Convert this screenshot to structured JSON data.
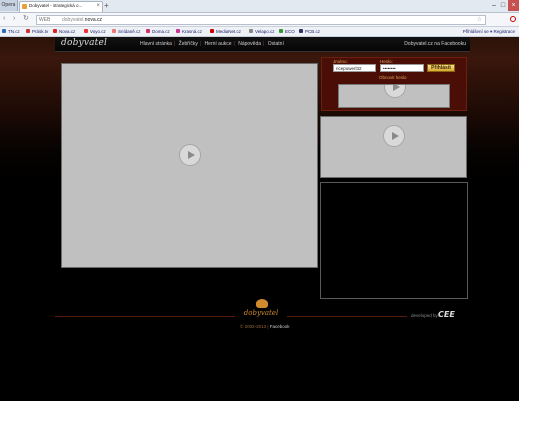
{
  "browser": {
    "menu_label": "Opera",
    "tab_title": "Dobyvatel - strategická o...",
    "tab_close": "×",
    "new_tab": "+",
    "address_domain_faded": "dobyvatel.",
    "address_domain_strong": "novа.cz",
    "web_badge": "WEB",
    "bookmarks": [
      "TN.cz",
      "Prásk.tv",
      "Nova.cz",
      "Voyo.cz",
      "Snídaně.cz",
      "Doma.cz",
      "Krasná.cz",
      "MediaNet.cz",
      "Velapo.cz",
      "ECO",
      "PCB.cz"
    ],
    "bookmarks_right": "Přihlášení se ▾   Registrace"
  },
  "site": {
    "logo": "dobyvatel",
    "menu": [
      "Hlavní stránka",
      "Žebříčky",
      "Herní aukce",
      "Nápověda",
      "Ostatní"
    ],
    "facebook_link": "Dobyvatel.cz na Facebooku",
    "login": {
      "username_label": "Jméno:",
      "username_value": "ricepowerl32",
      "password_label": "Heslo:",
      "password_value": "••••••••",
      "submit": "Přihlásit",
      "recover": "Obnovit heslo"
    },
    "footer": {
      "logo": "dobyvatel",
      "copyright": "© 2002-2013",
      "copyright_link": "Facebook",
      "developed_by": "developed by:",
      "developer": "CEE"
    }
  },
  "colors": {
    "accent": "#d08a2e",
    "login_bg": "#4a0e06",
    "placeholder": "#c0c0c0"
  }
}
